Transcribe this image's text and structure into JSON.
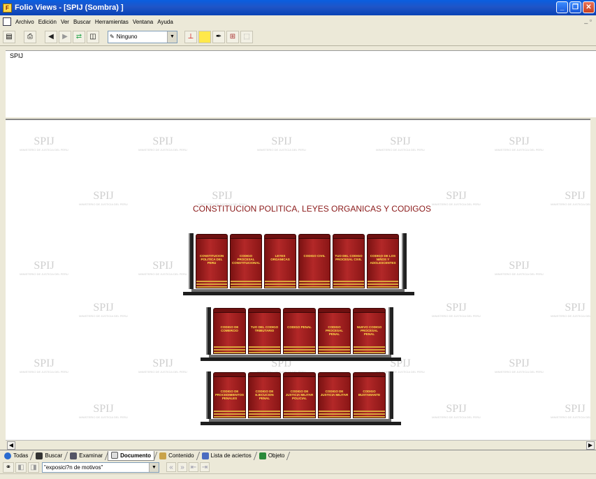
{
  "window": {
    "title": "Folio Views - [SPIJ (Sombra) ]"
  },
  "menu": {
    "items": [
      "Archivo",
      "Edición",
      "Ver",
      "Buscar",
      "Herramientas",
      "Ventana",
      "Ayuda"
    ]
  },
  "toolbar": {
    "highlighter_value": "Ninguno"
  },
  "header_pane": {
    "text": "SPIJ"
  },
  "watermark": {
    "logo": "SPIJ",
    "caption": "MINISTERIO DE JUSTICIA DEL PERU"
  },
  "document": {
    "title_first_letter": "C",
    "title_rest": "ONSTITUCION  POLITICA, LEYES ORGANICAS Y CODIGOS",
    "shelves": [
      {
        "books": [
          "CONSTITUCION POLITICA DEL PERU",
          "CODIGO PROCESAL CONSTITUCIONAL",
          "LEYES ORGANICAS",
          "CODIGO CIVIL",
          "TUO DEL CODIGO PROCESAL CIVIL",
          "CODIGO DE LOS NIÑOS Y ADOLESCENTES"
        ]
      },
      {
        "books": [
          "CODIGO DE COMERCIO",
          "TUO DEL CODIGO TRIBUTARIO",
          "CODIGO PENAL",
          "CODIGO PROCESAL PENAL",
          "NUEVO CODIGO PROCESAL PENAL"
        ]
      },
      {
        "books": [
          "CODIGO DE PROCEDIMIENTOS PENALES",
          "CODIGO DE EJECUCION PENAL",
          "CODIGO DE JUSTICIA MILITAR POLICIAL",
          "CODIGO DE JUSTICIA MILITAR",
          "CODIGO BUSTAMANTE"
        ]
      }
    ]
  },
  "tabs": [
    "Todas",
    "Buscar",
    "Examinar",
    "Documento",
    "Contenido",
    "Lista de aciertos",
    "Objeto"
  ],
  "search": {
    "query": "\"exposici?n de motivos\""
  },
  "colors": {
    "titlebar": "#1f55c7",
    "book": "#b32828",
    "book_label": "#ffe04a",
    "title_text": "#8b1a1a"
  }
}
